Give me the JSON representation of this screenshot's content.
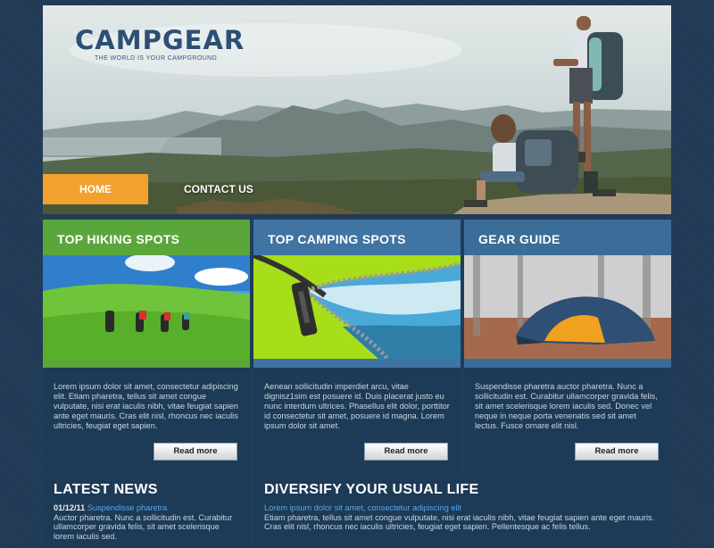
{
  "brand": {
    "name": "CAMPGEAR",
    "tagline": "THE WORLD IS YOUR CAMPGROUND"
  },
  "nav": [
    {
      "label": "HOME",
      "active": true
    },
    {
      "label": "CONTACT US",
      "active": false
    }
  ],
  "colors": {
    "accent": "#f2a22c",
    "green": "#5aa63a",
    "blue": "#3a6f9c",
    "panel": "#1d3a56",
    "link": "#5aa7e8"
  },
  "columns": [
    {
      "title": "TOP HIKING SPOTS",
      "head_color": "#5aa63a",
      "text": "Lorem ipsum dolor sit amet, consectetur adipiscing elit. Etiam pharetra, tellus sit amet congue vulputate, nisi erat iaculis nibh, vitae feugiat sapien ante eget mauris. Cras elit nisl, rhoncus nec iaculis ultricies, feugiat eget sapien.",
      "button": "Read more"
    },
    {
      "title": "TOP CAMPING SPOTS",
      "head_color": "#3f74a3",
      "text": "Aenean sollicitudin imperdiet arcu, vitae dignisz1sim est posuere id. Duis placerat justo eu nunc interdum ultrices. Phasellus elit dolor, porttitor id consectetur sit amet, posuere id magna. Lorem ipsum dolor sit amet.",
      "button": "Read more"
    },
    {
      "title": "GEAR GUIDE",
      "head_color": "#3a6d98",
      "text": "Suspendisse pharetra auctor pharetra. Nunc a sollicitudin est. Curabitur ullamcorper gravida felis, sit amet scelerisque lorem iaculis sed. Donec vel neque in neque porta venenatis sed sit amet lectus. Fusce ornare elit nisl.",
      "button": "Read more"
    }
  ],
  "news": {
    "title": "LATEST NEWS",
    "date": "01/12/11",
    "headline": "Suspendisse pharetra",
    "text": "Auctor pharetra. Nunc a sollicitudin est. Curabitur ullamcorper gravida felis, sit amet scelerisque lorem iaculis sed."
  },
  "diversify": {
    "title": "DIVERSIFY YOUR USUAL LIFE",
    "lead": "Lorem ipsum dolor sit amet, consectetur adipiscing elit",
    "text": "Etiam pharetra, tellus sit amet congue vulputate, nisi erat iaculis nibh, vitae feugiat sapien ante eget mauris. Cras elit nisl, rhoncus nec iaculis ultricies, feugiat eget sapien. Pellentesque ac felis tellus."
  }
}
